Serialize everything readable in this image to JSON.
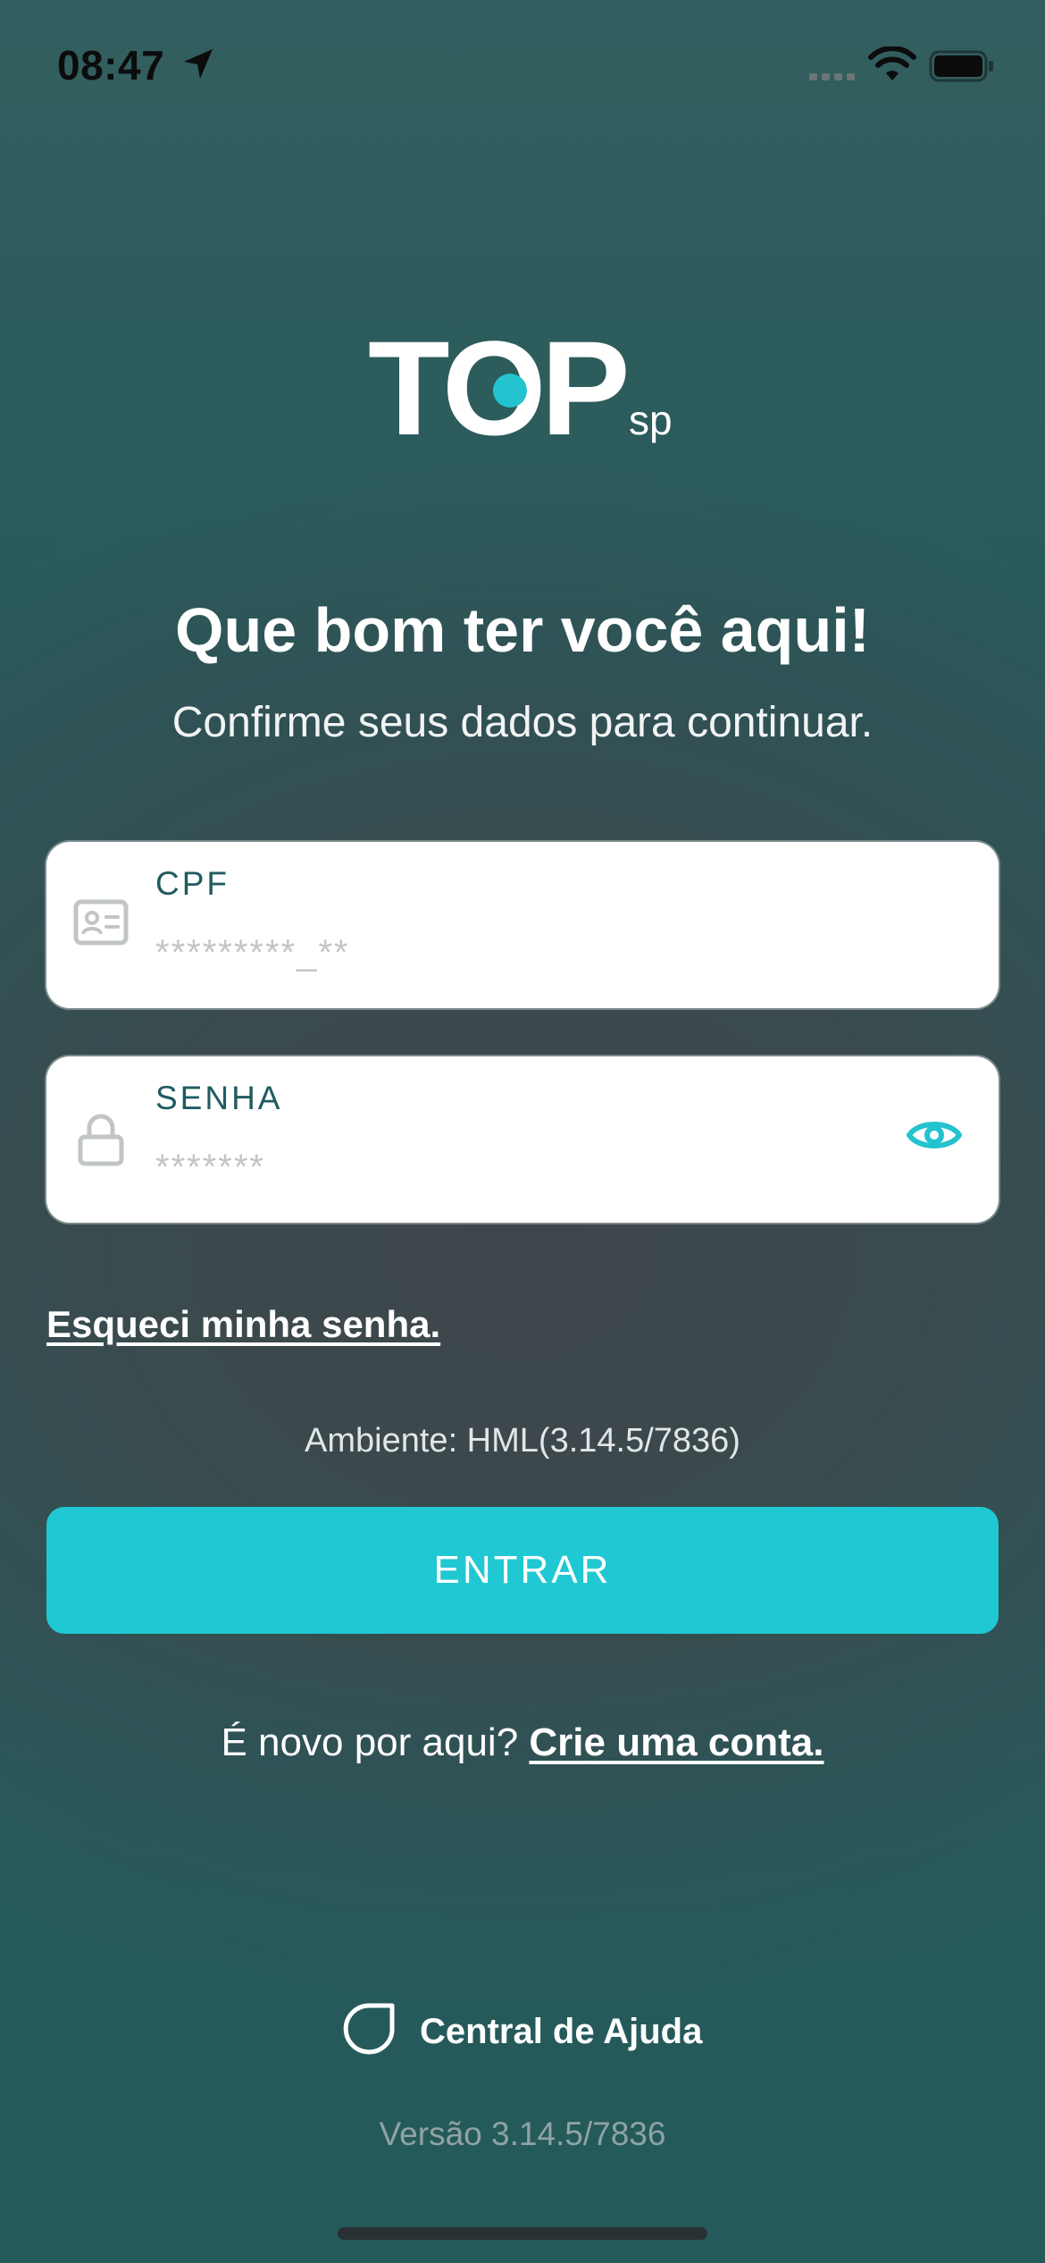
{
  "status_bar": {
    "time": "08:47",
    "icons": [
      "location-arrow-icon",
      "signal-icon",
      "wifi-icon",
      "battery-icon"
    ]
  },
  "logo": {
    "wordmark": "TOP",
    "sub": "sp"
  },
  "header": {
    "title": "Que bom ter você aqui!",
    "subtitle": "Confirme seus dados para continuar."
  },
  "form": {
    "cpf": {
      "label": "CPF",
      "placeholder": "*********_**",
      "value": "",
      "icon": "id-card-icon"
    },
    "senha": {
      "label": "SENHA",
      "placeholder": "*******",
      "value": "",
      "icon": "lock-icon",
      "toggle_icon": "eye-icon"
    },
    "forgot_label": "Esqueci minha senha.",
    "environment": "Ambiente: HML(3.14.5/7836)",
    "submit_label": "ENTRAR"
  },
  "signup": {
    "prompt": "É novo por aqui?",
    "link": "Crie uma conta."
  },
  "footer": {
    "help_label": "Central de Ajuda",
    "help_icon": "help-center-icon",
    "version": "Versão 3.14.5/7836"
  },
  "colors": {
    "accent": "#1FC8D2",
    "background_top": "#355F60",
    "background_mid": "#3F464B",
    "background_bottom": "#285A5A",
    "field_label": "#1F5B60",
    "field_icon": "#C2C5C7"
  }
}
